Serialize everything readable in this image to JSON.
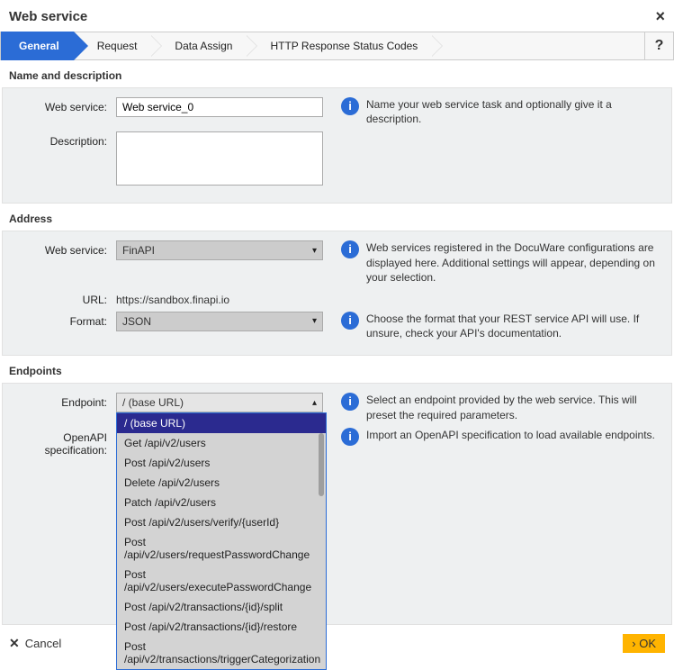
{
  "dialog": {
    "title": "Web service",
    "close_icon": "×"
  },
  "tabs": {
    "t0": "General",
    "t1": "Request",
    "t2": "Data Assign",
    "t3": "HTTP Response Status Codes",
    "help": "?"
  },
  "sections": {
    "name_desc": "Name and description",
    "address": "Address",
    "endpoints": "Endpoints"
  },
  "name_desc": {
    "ws_label": "Web service:",
    "ws_value": "Web service_0",
    "desc_label": "Description:",
    "desc_value": "",
    "hint": "Name your web service task and optionally give it a description."
  },
  "address": {
    "ws_label": "Web service:",
    "ws_selected": "FinAPI",
    "url_label": "URL:",
    "url_value": "https://sandbox.finapi.io",
    "format_label": "Format:",
    "format_selected": "JSON",
    "hint_ws": "Web services registered in the DocuWare configurations are displayed here. Additional settings will appear, depending on your selection.",
    "hint_format": "Choose the format that your REST service API will use. If unsure, check your API's documentation."
  },
  "endpoints": {
    "ep_label": "Endpoint:",
    "ep_selected": "/ (base URL)",
    "spec_label": "OpenAPI specification:",
    "hint_ep": "Select an endpoint provided by the web service. This will preset the required parameters.",
    "hint_spec": "Import an OpenAPI specification to load available endpoints.",
    "options": {
      "o0": "/ (base URL)",
      "o1": "Get   /api/v2/users",
      "o2": "Post   /api/v2/users",
      "o3": "Delete   /api/v2/users",
      "o4": "Patch   /api/v2/users",
      "o5": "Post   /api/v2/users/verify/{userId}",
      "o6": "Post   /api/v2/users/requestPasswordChange",
      "o7": "Post   /api/v2/users/executePasswordChange",
      "o8": "Post   /api/v2/transactions/{id}/split",
      "o9": "Post   /api/v2/transactions/{id}/restore",
      "o10": "Post   /api/v2/transactions/triggerCategorization"
    }
  },
  "footer": {
    "cancel_icon": "✕",
    "cancel": "Cancel",
    "ok": "› OK"
  }
}
